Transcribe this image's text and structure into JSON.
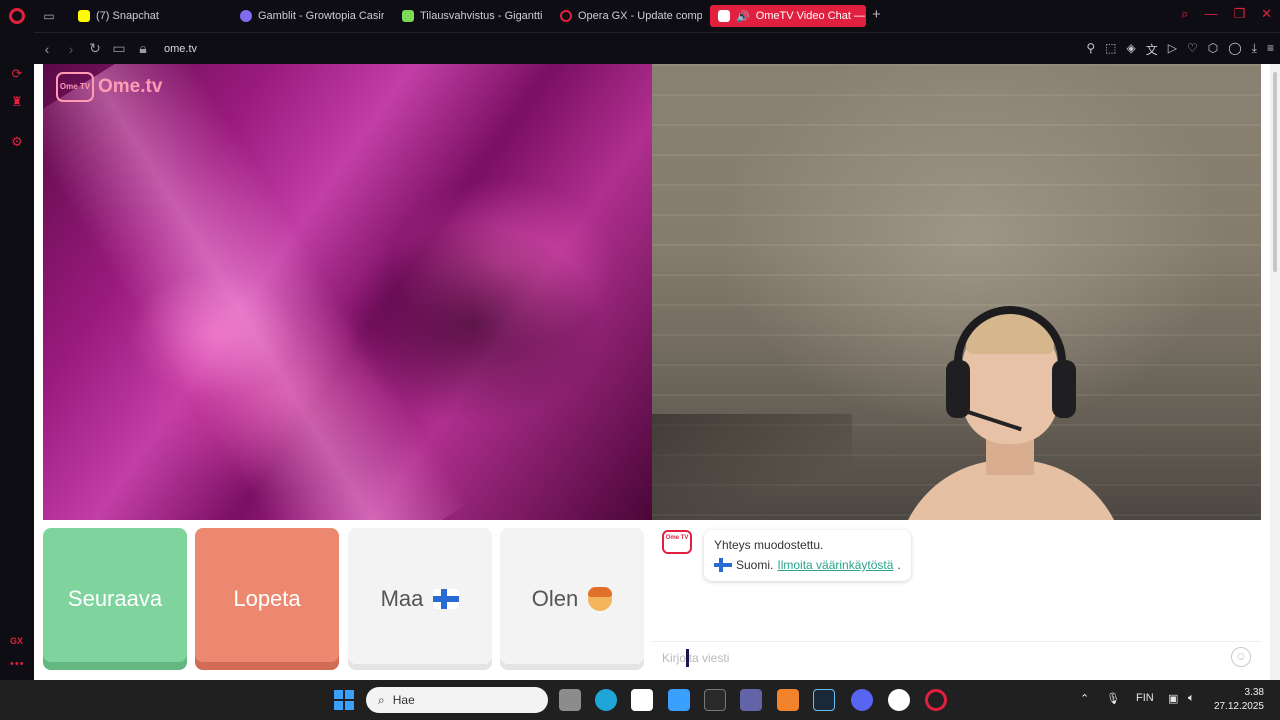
{
  "browser": {
    "tabs": [
      {
        "label": "(7) Snapchat",
        "favicon_color": "#fffc00"
      },
      {
        "label": "Gamblit - Growtopia Casin",
        "favicon_color": "#7e6cf0"
      },
      {
        "label": "Tilausvahvistus - Gigantti",
        "favicon_color": "#7ed957"
      },
      {
        "label": "Opera GX - Update compl",
        "favicon_color": "#e1203f"
      },
      {
        "label": "OmeTV Video Chat —",
        "favicon_color": "#ffffff",
        "active": true
      }
    ],
    "address": "ome.tv",
    "accent": "#e1203f"
  },
  "sidebar": {
    "gx_label": "GX",
    "more_label": "•••"
  },
  "ometv": {
    "logo_box_text": "Ome TV",
    "logo_text": "Ome.tv",
    "buttons": {
      "next": "Seuraava",
      "stop": "Lopeta",
      "country": "Maa",
      "gender": "Olen"
    },
    "chat": {
      "avatar_text": "Ome TV",
      "connected": "Yhteys muodostettu.",
      "country_name": "Suomi.",
      "report_link": "Ilmoita väärinkäytöstä",
      "period": ".",
      "placeholder": "Kirjoita viesti"
    }
  },
  "taskbar": {
    "search_placeholder": "Hae",
    "language": "FIN",
    "time": "3.38",
    "date": "27.12.2025",
    "apps": [
      {
        "name": "file-explorer",
        "color": "#8c8c8c"
      },
      {
        "name": "edge",
        "color": "#1fa6d9"
      },
      {
        "name": "store",
        "color": "#ffffff"
      },
      {
        "name": "photos",
        "color": "#3aa0ff"
      },
      {
        "name": "epic-games",
        "color": "#2a2a2a"
      },
      {
        "name": "teams",
        "color": "#6264a7"
      },
      {
        "name": "affinity",
        "color": "#f0832b"
      },
      {
        "name": "steam",
        "color": "#1b2838"
      },
      {
        "name": "discord",
        "color": "#5865f2"
      },
      {
        "name": "obs",
        "color": "#ffffff"
      },
      {
        "name": "opera-gx",
        "color": "#e1203f"
      }
    ]
  }
}
